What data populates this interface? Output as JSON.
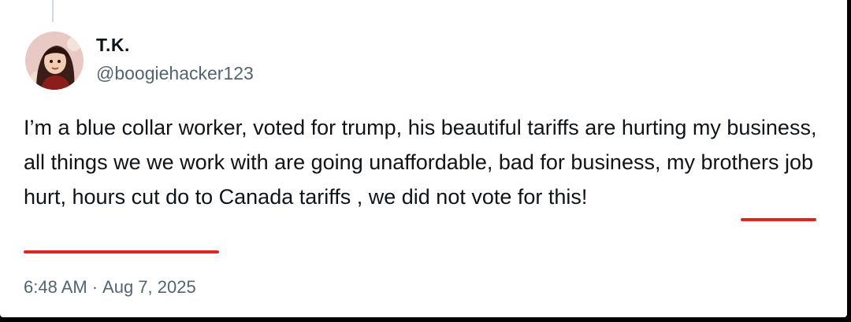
{
  "tweet": {
    "display_name": "T.K.",
    "handle": "@boogiehacker123",
    "text_part1": "I’m a blue collar worker, voted for trump,  his beautiful tariffs are hurting my business, all things we we work with are going unaffordable, bad for business, my brothers job hurt, hours cut do to Canada tariffs , ",
    "text_highlight": "we did not vote for this!",
    "time": "6:48 AM",
    "separator": "·",
    "date": "Aug 7, 2025"
  },
  "colors": {
    "text": "#0f1419",
    "secondary": "#536471",
    "underline": "#e02424",
    "background": "#ffffff"
  },
  "icons": {
    "avatar": "user-avatar-illustration"
  }
}
